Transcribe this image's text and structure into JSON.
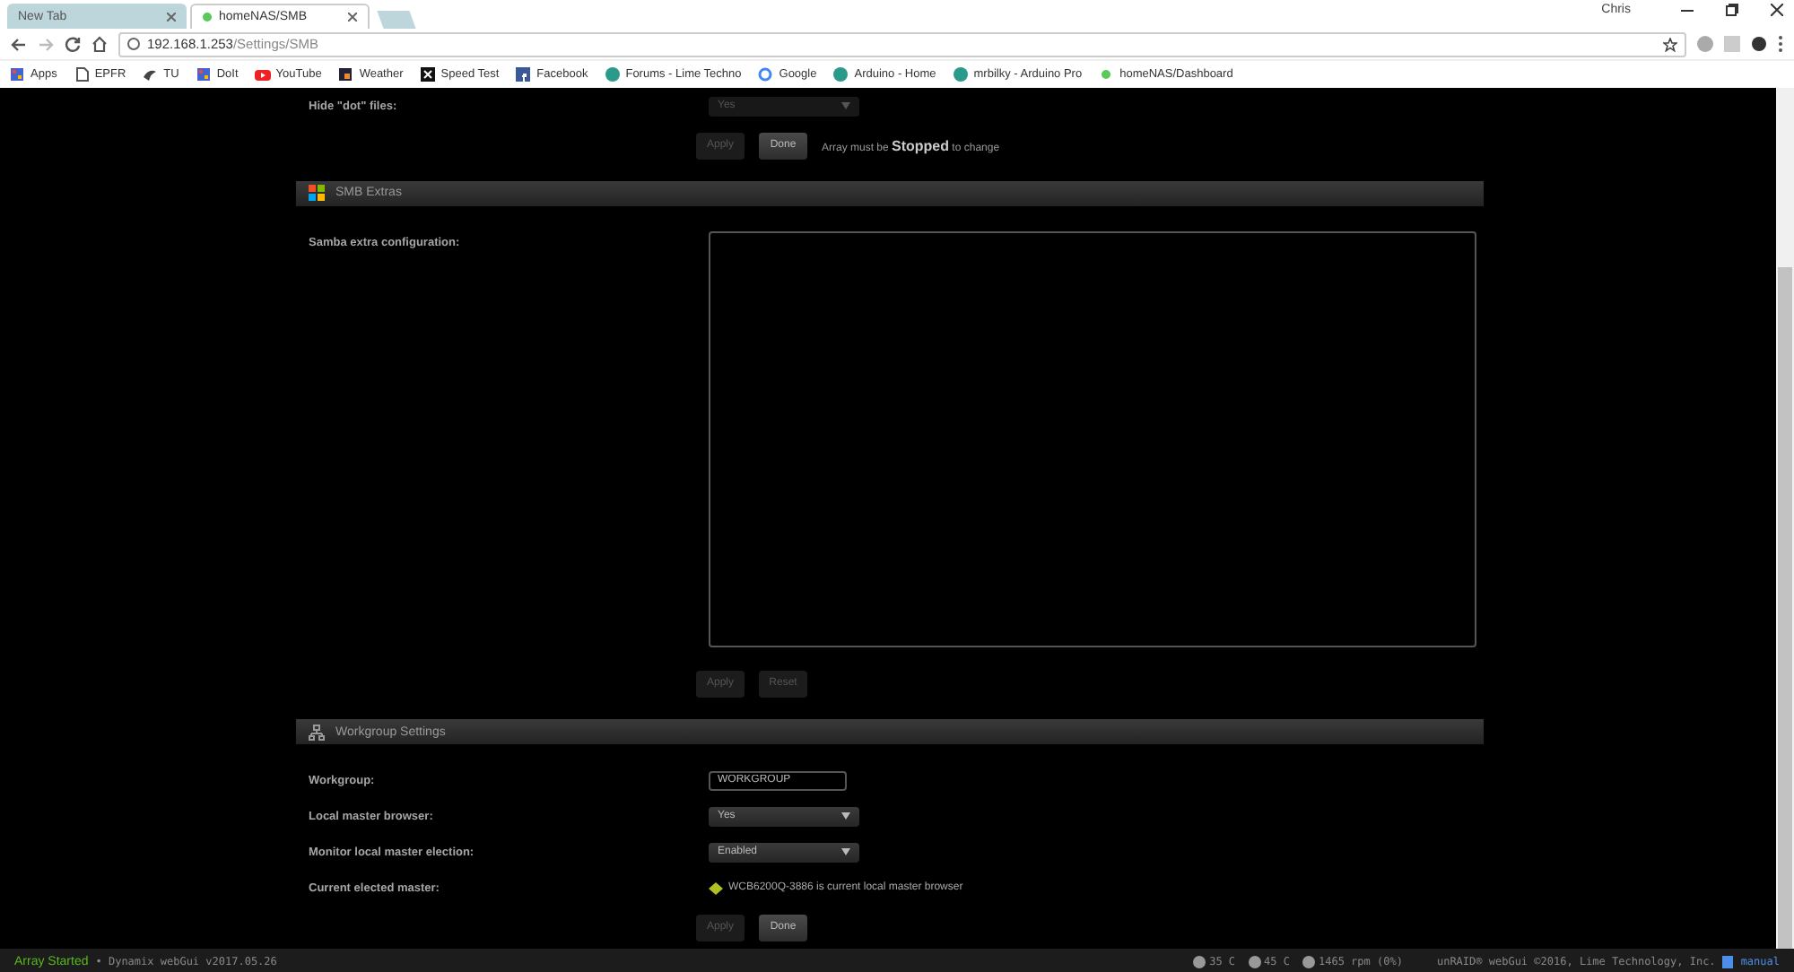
{
  "browser": {
    "tabs": [
      {
        "label": "New Tab",
        "selected": false,
        "favicon": false
      },
      {
        "label": "homeNAS/SMB",
        "selected": true,
        "favicon": true
      }
    ],
    "profile": "Chris",
    "address": {
      "host": "192.168.1.253",
      "path": "/Settings/SMB"
    },
    "bookmarks": [
      {
        "label": "Apps",
        "kind": "grid"
      },
      {
        "label": "EPFR",
        "kind": "page"
      },
      {
        "label": "TU",
        "kind": "bird"
      },
      {
        "label": "DoIt",
        "kind": "grid"
      },
      {
        "label": "YouTube",
        "kind": "play"
      },
      {
        "label": "Weather",
        "kind": "square"
      },
      {
        "label": "Speed Test",
        "kind": "x"
      },
      {
        "label": "Facebook",
        "kind": "f"
      },
      {
        "label": "Forums - Lime Techno",
        "kind": "circle"
      },
      {
        "label": "Google",
        "kind": "g"
      },
      {
        "label": "Arduino - Home",
        "kind": "circle"
      },
      {
        "label": "mrbilky - Arduino Pro",
        "kind": "circle"
      },
      {
        "label": "homeNAS/Dashboard",
        "kind": "dot"
      }
    ]
  },
  "top_section": {
    "rows": [
      {
        "label": "Hide \"dot\" files:",
        "kind": "select",
        "value": "Yes",
        "disabled": true
      }
    ],
    "buttons": [
      {
        "label": "Apply",
        "disabled": true
      },
      {
        "label": "Done",
        "disabled": false
      }
    ],
    "note": "Array must be **Stopped** to change"
  },
  "sections": [
    {
      "title": "SMB Extras",
      "rows": [
        {
          "label": "Samba extra configuration:",
          "kind": "textarea",
          "value": ""
        }
      ],
      "buttons": [
        {
          "label": "Apply",
          "disabled": true
        },
        {
          "label": "Reset",
          "disabled": true
        }
      ]
    },
    {
      "title": "Workgroup Settings",
      "rows": [
        {
          "label": "Workgroup:",
          "kind": "input",
          "value": "WORKGROUP"
        },
        {
          "label": "Local master browser:",
          "kind": "select",
          "value": "Yes",
          "disabled": false
        },
        {
          "label": "Monitor local master election:",
          "kind": "select",
          "value": "Enabled",
          "disabled": false
        },
        {
          "label": "Current elected master:",
          "kind": "status",
          "value": "WCB6200Q-3886 is current local master browser"
        }
      ],
      "buttons": [
        {
          "label": "Apply",
          "disabled": true
        },
        {
          "label": "Done",
          "disabled": false
        }
      ]
    }
  ],
  "status_bar": {
    "array_state": "Array Started",
    "version": "• Dynamix webGui v2017.05.26",
    "readings": [
      "35 C",
      "45 C",
      "1465 rpm (0%)"
    ],
    "copyright": "unRAID® webGui ©2016, Lime Technology, Inc.",
    "manual": "manual"
  }
}
